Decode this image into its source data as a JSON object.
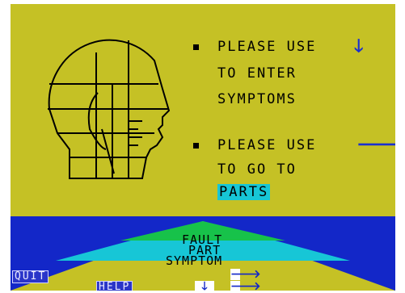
{
  "instructions": {
    "line1": "PLEASE USE",
    "line2": "TO ENTER",
    "line3": "SYMPTOMS",
    "line4": "PLEASE USE",
    "line5": "TO GO TO",
    "parts_label": "PARTS"
  },
  "hierarchy": {
    "fault": "FAULT",
    "part": "PART",
    "symptom": "SYMPTOM"
  },
  "menu": {
    "quit": "QUIT",
    "help": "HELP"
  },
  "icons": {
    "down": "down-arrow-icon",
    "right": "right-arrow-icon"
  },
  "colors": {
    "background": "#c5c125",
    "band": "#1327c8",
    "fault": "#17c24a",
    "part": "#17c6d6",
    "symptom": "#c5c125",
    "arrow": "#1a2fd0"
  }
}
